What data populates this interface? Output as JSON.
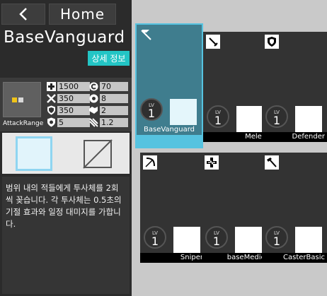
{
  "header": {
    "back_icon": "chevron-left-icon",
    "home_label": "Home"
  },
  "unit": {
    "name": "BaseVanguard",
    "detail_label": "상세 정보",
    "range_label": "AttackRange",
    "stats": {
      "hp": "1500",
      "atk": "350",
      "def": "350",
      "res": "5",
      "cost": "70",
      "block": "8",
      "redeploy": "2",
      "speed": "1.2"
    },
    "description": "범위 내의 적들에게 투사체를 2회씩 꽂습니다. 각 투사체는 0.5초의 기절 효과와 일정 대미지를 가합니다."
  },
  "cards": [
    {
      "name": "BaseVanguard",
      "lv_label": "LV",
      "lv": "1",
      "icon": "flag-icon",
      "selected": true
    },
    {
      "name": "Melee",
      "lv_label": "LV",
      "lv": "1",
      "icon": "sword-icon",
      "selected": false
    },
    {
      "name": "Defender",
      "lv_label": "LV",
      "lv": "1",
      "icon": "shield-icon",
      "selected": false
    },
    {
      "name": "Sniper",
      "lv_label": "LV",
      "lv": "1",
      "icon": "bow-icon",
      "selected": false
    },
    {
      "name": "baseMedic",
      "lv_label": "LV",
      "lv": "1",
      "icon": "medic-cross-icon",
      "selected": false
    },
    {
      "name": "CasterBasic",
      "lv_label": "LV",
      "lv": "1",
      "icon": "staff-icon",
      "selected": false
    }
  ],
  "colors": {
    "accent": "#23c5c5",
    "selected_card": "#3f7d8e",
    "selection_frame": "#56c3e0"
  }
}
